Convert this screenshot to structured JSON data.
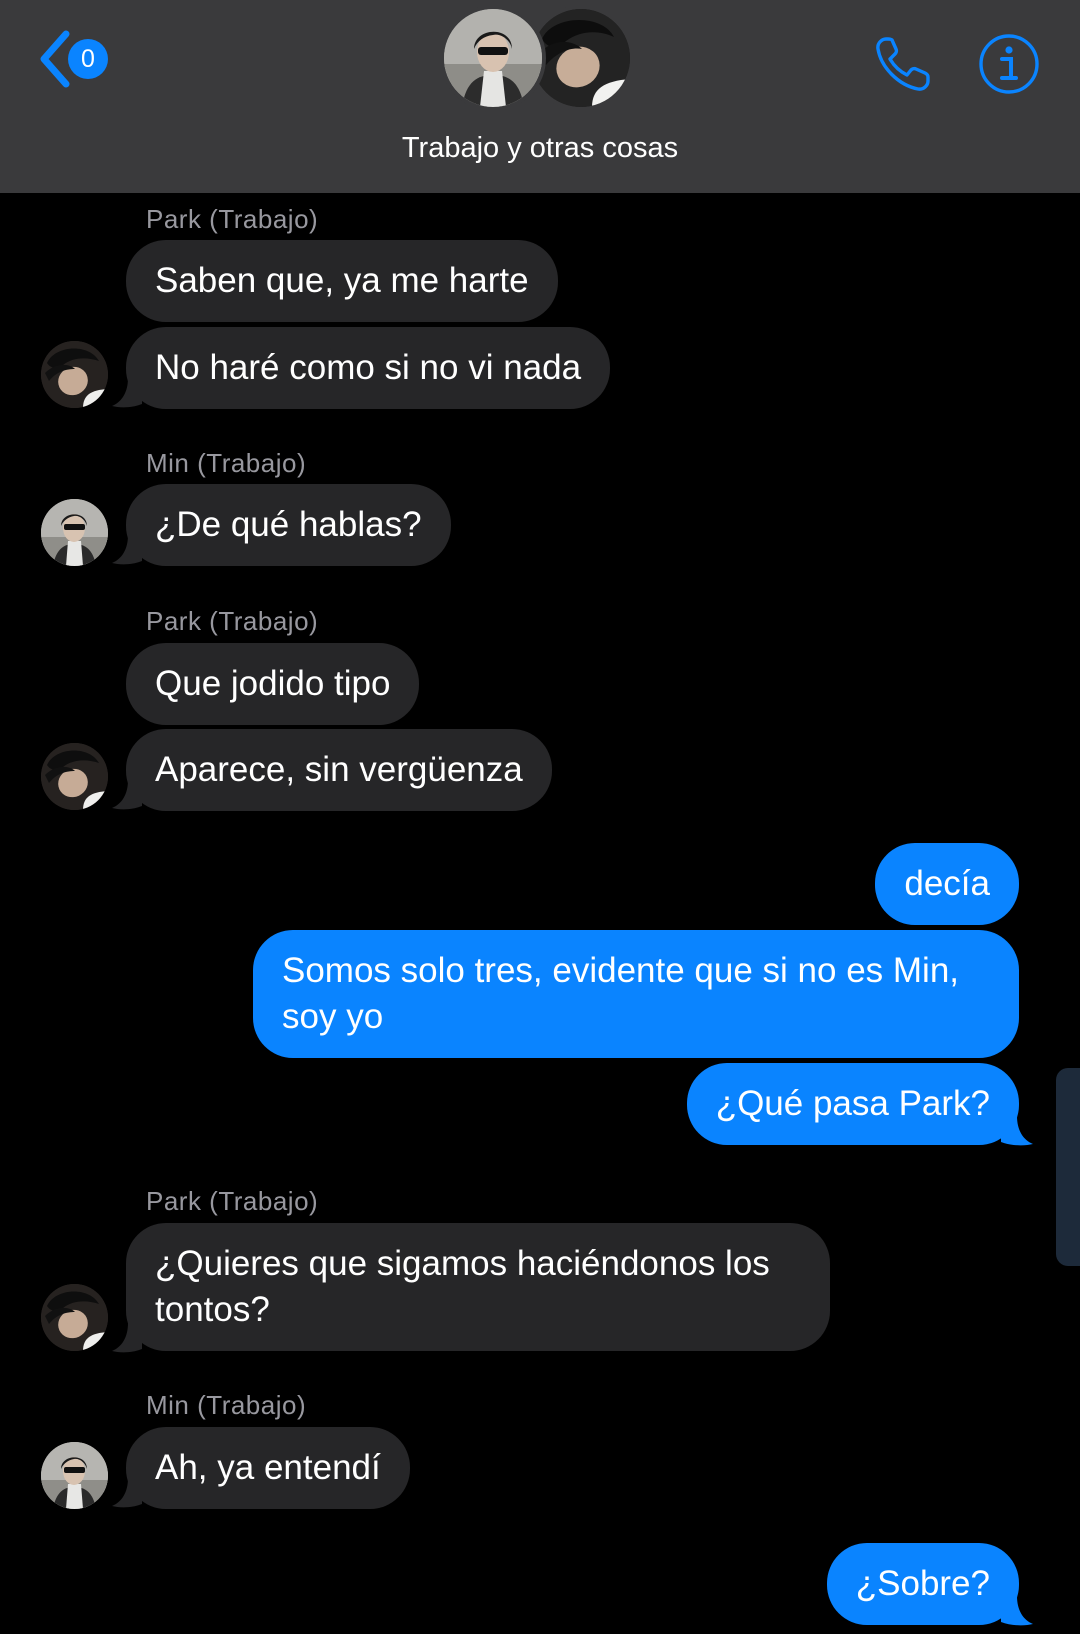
{
  "header": {
    "back_count": "0",
    "group_name": "Trabajo y otras cosas"
  },
  "colors": {
    "header_bg": "#3a3a3c",
    "accent": "#0a84ff",
    "incoming_bubble": "#262628",
    "outgoing_bubble": "#0a84ff",
    "sender_label": "#98989f",
    "background": "#000000"
  },
  "icons": {
    "back": "chevron-left-icon",
    "call": "phone-icon",
    "info": "info-icon"
  },
  "messages": [
    {
      "sender": "Park (Trabajo)"
    },
    {
      "text": "Saben que, ya me harte"
    },
    {
      "text": "No haré como si no vi nada"
    },
    {
      "sender": "Min (Trabajo)"
    },
    {
      "text": "¿De qué hablas?"
    },
    {
      "sender": "Park (Trabajo)"
    },
    {
      "text": "Que jodido tipo"
    },
    {
      "text": "Aparece, sin vergüenza"
    },
    {
      "text": "decía"
    },
    {
      "text": "Somos solo tres, evidente que si no es Min,"
    },
    {
      "text": "soy yo"
    },
    {
      "text": "¿Qué pasa Park?"
    },
    {
      "sender": "Park (Trabajo)"
    },
    {
      "text": "¿Quieres que sigamos haciéndonos los"
    },
    {
      "text": "tontos?"
    },
    {
      "sender": "Min (Trabajo)"
    },
    {
      "text": "Ah, ya entendí"
    },
    {
      "text": "¿Sobre?"
    }
  ]
}
